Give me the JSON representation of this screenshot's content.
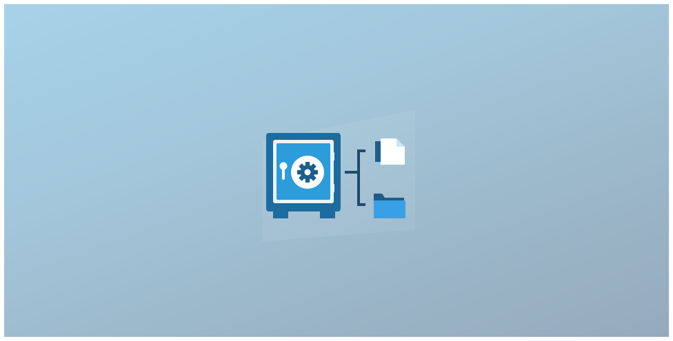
{
  "scene": {
    "background": {
      "gradient_start": "#a6d2e8",
      "gradient_end": "#94abbd"
    },
    "illustration": {
      "elements": [
        "safe-icon",
        "gear-icon",
        "keyhole-icon",
        "bracket",
        "document-icon",
        "folder-icon"
      ],
      "colors": {
        "safe_body": "#1c6c9f",
        "safe_door": "#2c9cdb",
        "dial": "#ffffff",
        "gear": "#1b5f8c",
        "bracket": "#1e4a6a",
        "document": "#ffffff",
        "folder": "#3aa0e6"
      }
    }
  }
}
